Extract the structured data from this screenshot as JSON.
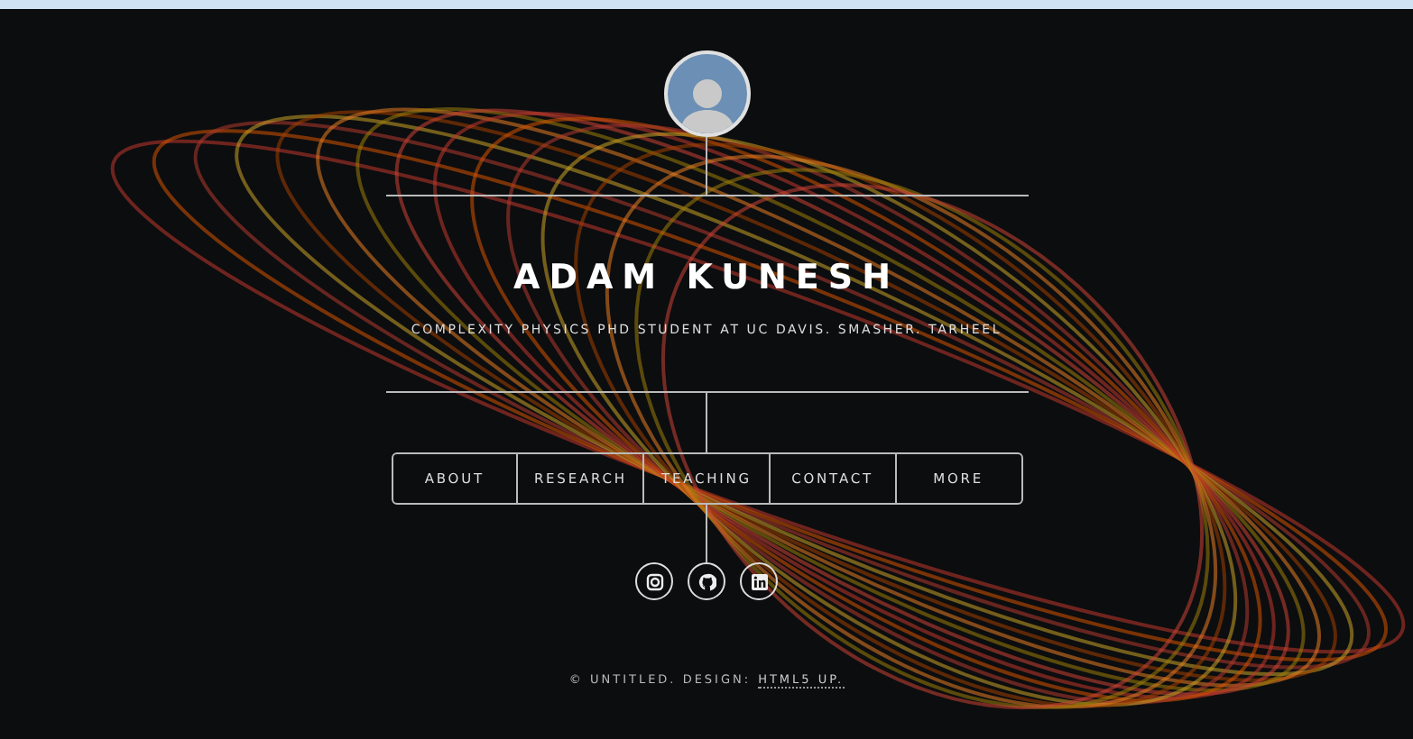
{
  "header": {
    "name": "ADAM KUNESH",
    "tagline": "COMPLEXITY PHYSICS PHD STUDENT AT UC DAVIS. SMASHER. TARHEEL"
  },
  "nav": [
    "ABOUT",
    "RESEARCH",
    "TEACHING",
    "CONTACT",
    "MORE"
  ],
  "social": [
    {
      "kind": "instagram"
    },
    {
      "kind": "github"
    },
    {
      "kind": "linkedin"
    }
  ],
  "footer": {
    "text": "© UNTITLED. DESIGN:",
    "link": "HTML5 UP."
  }
}
